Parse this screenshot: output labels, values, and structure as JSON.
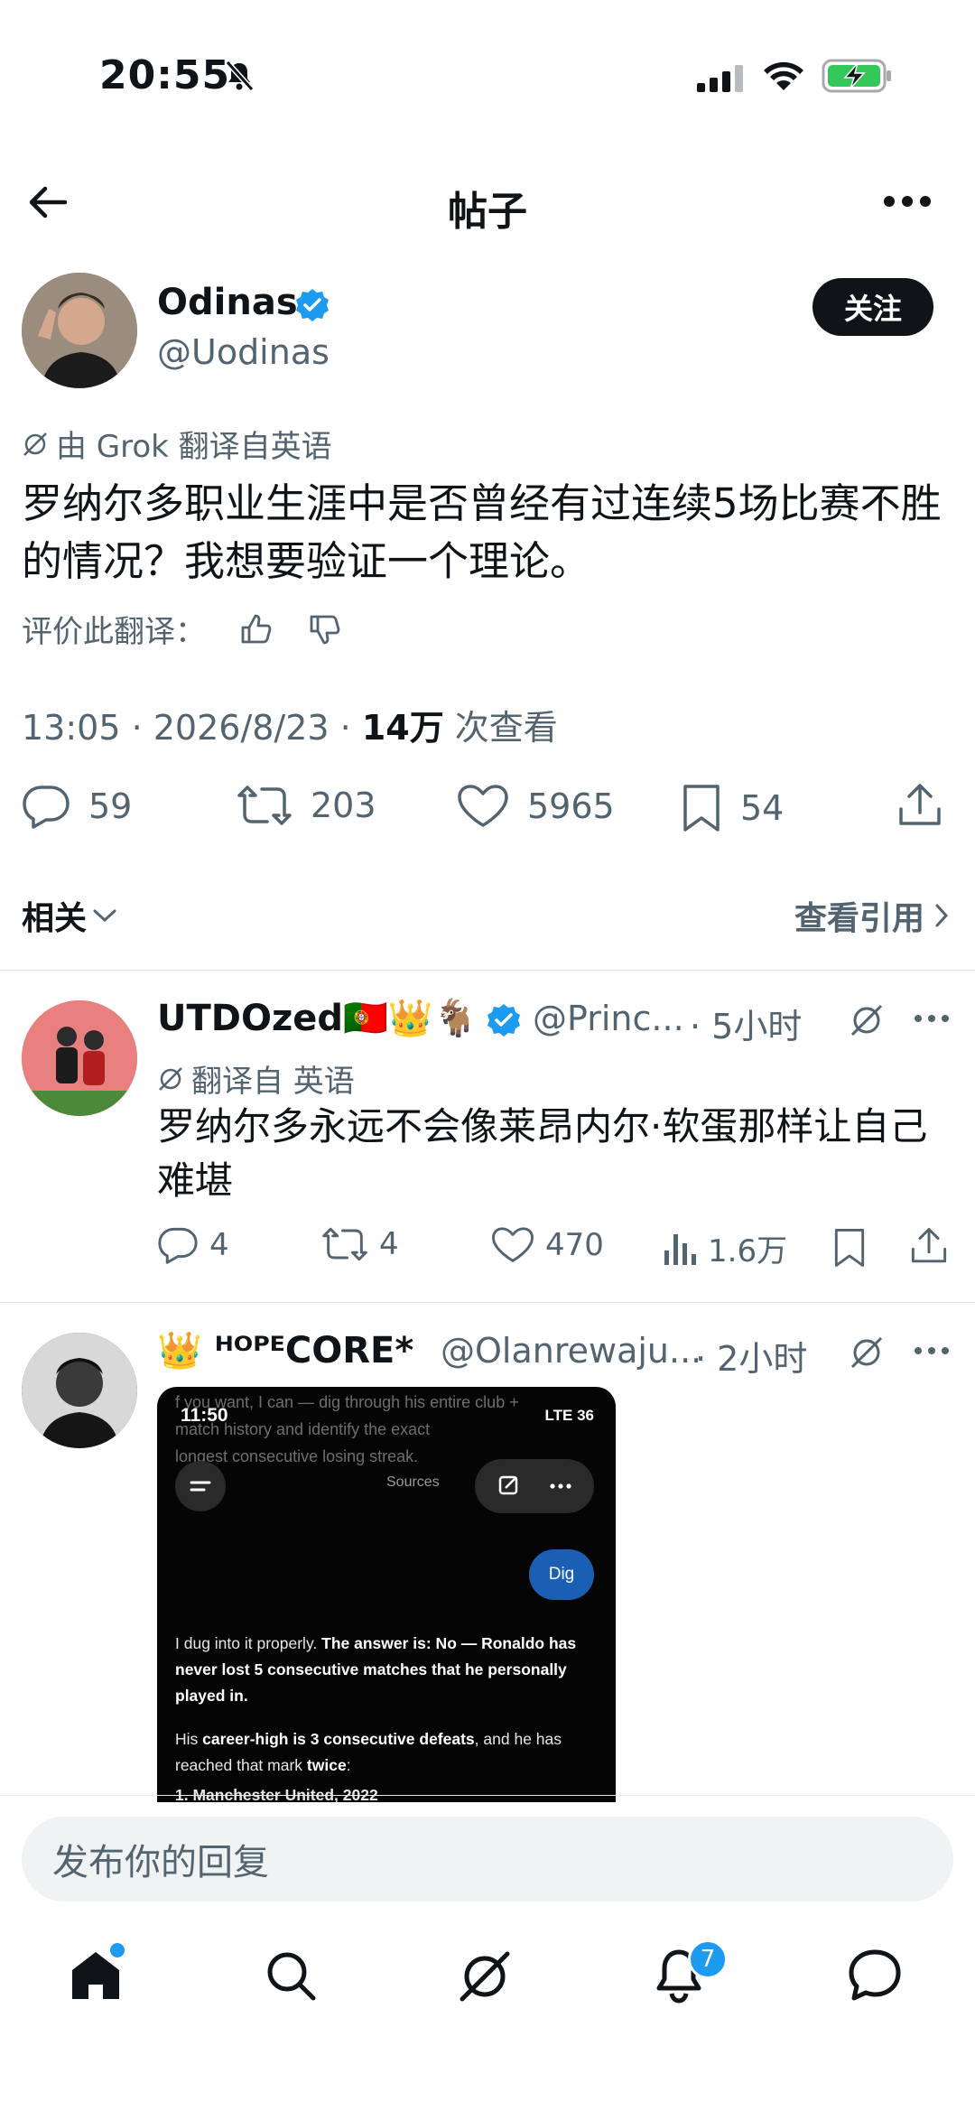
{
  "status_bar": {
    "time": "20:55"
  },
  "header": {
    "title": "帖子"
  },
  "post": {
    "author_name": "Odinas",
    "author_handle": "@Uodinas",
    "follow_label": "关注",
    "translation_note": "由 Grok 翻译自英语",
    "text": "罗纳尔多职业生涯中是否曾经有过连续5场比赛不胜的情况？我想要验证一个理论。",
    "rate_label": "评价此翻译：",
    "time": "13:05 · 2026/8/23 · ",
    "views_count": "14万",
    "views_label": " 次查看",
    "replies": "59",
    "reposts": "203",
    "likes": "5965",
    "bookmarks": "54"
  },
  "related": {
    "label": "相关",
    "quotes_label": "查看引用"
  },
  "replies": [
    {
      "name": "UTDOzed🇵🇹👑🐐",
      "handle": "@Princ...",
      "time": "· 5小时",
      "translation_note": "翻译自 英语",
      "text": "罗纳尔多永远不会像莱昂内尔·软蛋那样让自己难堪",
      "replies": "4",
      "reposts": "4",
      "likes": "470",
      "views": "1.6万"
    },
    {
      "name": "👑 ᴴᴼᴾᴱCORE*",
      "handle": "@Olanrewaju...",
      "time": "· 2小时",
      "image": {
        "ghost_text": "f you want, I can — dig through his entire club +\nmatch history and identify the exact\nlongest consecutive losing streak.",
        "time": "11:50",
        "network": "LTE 36",
        "sources_label": "Sources",
        "dig_label": "Dig",
        "para1_plain": "I dug into it properly. ",
        "para1_bold": "The answer is: No — Ronaldo has never lost 5 consecutive matches that he personally played in.",
        "para2_plain_a": "His ",
        "para2_bold": "career-high is 3 consecutive defeats",
        "para2_plain_b": ", and he has reached that mark ",
        "para2_bold2": "twice",
        "para2_end": ":",
        "list_item": "1.  Manchester United, 2022"
      }
    }
  ],
  "composer": {
    "placeholder": "发布你的回复"
  },
  "tabbar": {
    "notifications_badge": "7"
  },
  "colors": {
    "accent": "#1d9bf0",
    "text": "#0f1419",
    "muted": "#536471"
  }
}
